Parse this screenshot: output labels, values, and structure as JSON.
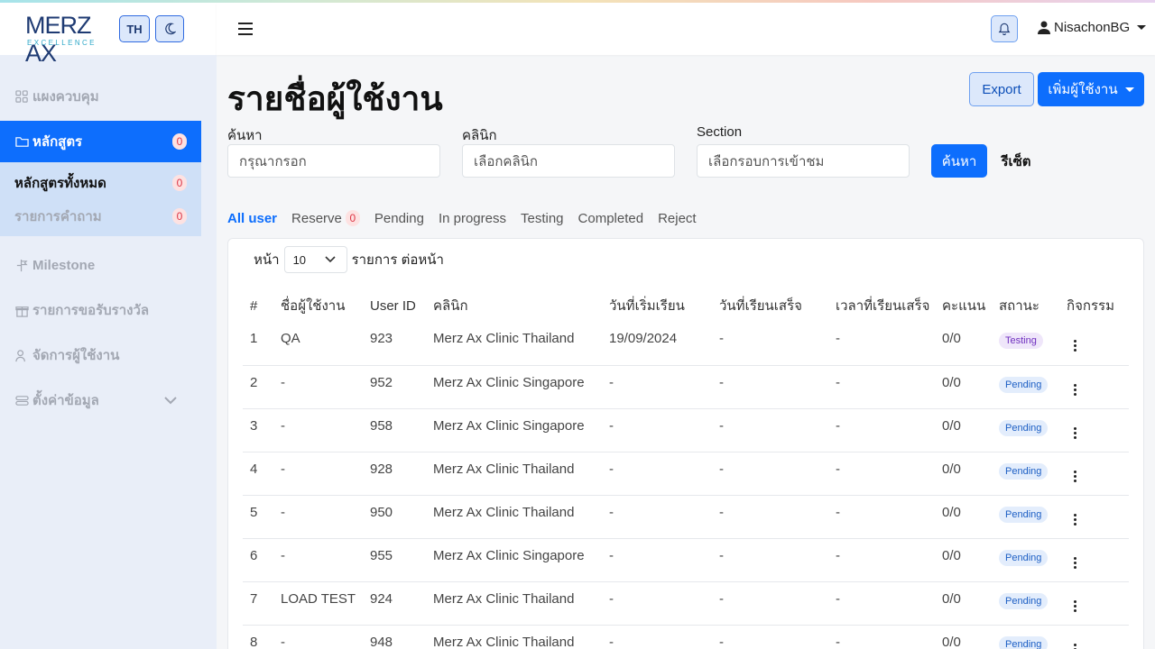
{
  "brand": {
    "logo_text": "MERZ AX",
    "logo_sub": "EXCELLENCE",
    "lang": "TH"
  },
  "header": {
    "username": "NisachonBG"
  },
  "sidebar": {
    "items": [
      {
        "label": "แผงควบคุม",
        "icon": "dashboard-icon"
      },
      {
        "label": "หลักสูตร",
        "icon": "folder-icon",
        "badge": "0",
        "active": true
      },
      {
        "label": "Milestone",
        "icon": "milestone-icon"
      },
      {
        "label": "รายการขอรับรางวัล",
        "icon": "gift-icon"
      },
      {
        "label": "จัดการผู้ใช้งาน",
        "icon": "users-icon"
      },
      {
        "label": "ตั้งค่าข้อมูล",
        "icon": "settings-icon"
      }
    ],
    "subitems": [
      {
        "label": "หลักสูตรทั้งหมด",
        "badge": "0"
      },
      {
        "label": "รายการคำถาม",
        "badge": "0"
      }
    ]
  },
  "page": {
    "title": "รายชื่อผู้ใช้งาน",
    "export_label": "Export",
    "add_label": "เพิ่มผู้ใช้งาน"
  },
  "filters": {
    "search_label": "ค้นหา",
    "search_placeholder": "กรุณากรอก",
    "clinic_label": "คลินิก",
    "clinic_placeholder": "เลือกคลินิก",
    "section_label": "Section",
    "section_placeholder": "เลือกรอบการเข้าชม",
    "search_button": "ค้นหา",
    "reset_button": "รีเซ็ต"
  },
  "tabs": [
    {
      "label": "All user",
      "active": true
    },
    {
      "label": "Reserve",
      "badge": "0"
    },
    {
      "label": "Pending"
    },
    {
      "label": "In progress"
    },
    {
      "label": "Testing"
    },
    {
      "label": "Completed"
    },
    {
      "label": "Reject"
    }
  ],
  "perpage": {
    "prefix": "หน้า",
    "value": "10",
    "suffix": "รายการ ต่อหน้า"
  },
  "table": {
    "columns": [
      "#",
      "ชื่อผู้ใช้งาน",
      "User ID",
      "คลินิก",
      "วันที่เริ่มเรียน",
      "วันที่เรียนเสร็จ",
      "เวลาที่เรียนเสร็จ",
      "คะแนน",
      "สถานะ",
      "กิจกรรม"
    ],
    "rows": [
      [
        "1",
        "QA",
        "923",
        "Merz Ax Clinic Thailand",
        "19/09/2024",
        "-",
        "-",
        "0/0",
        "Testing"
      ],
      [
        "2",
        "-",
        "952",
        "Merz Ax Clinic Singapore",
        "-",
        "-",
        "-",
        "0/0",
        "Pending"
      ],
      [
        "3",
        "-",
        "958",
        "Merz Ax Clinic Singapore",
        "-",
        "-",
        "-",
        "0/0",
        "Pending"
      ],
      [
        "4",
        "-",
        "928",
        "Merz Ax Clinic Thailand",
        "-",
        "-",
        "-",
        "0/0",
        "Pending"
      ],
      [
        "5",
        "-",
        "950",
        "Merz Ax Clinic Thailand",
        "-",
        "-",
        "-",
        "0/0",
        "Pending"
      ],
      [
        "6",
        "-",
        "955",
        "Merz Ax Clinic Singapore",
        "-",
        "-",
        "-",
        "0/0",
        "Pending"
      ],
      [
        "7",
        "LOAD TEST",
        "924",
        "Merz Ax Clinic Thailand",
        "-",
        "-",
        "-",
        "0/0",
        "Pending"
      ],
      [
        "8",
        "-",
        "948",
        "Merz Ax Clinic Thailand",
        "-",
        "-",
        "-",
        "0/0",
        "Pending"
      ]
    ]
  },
  "colors": {
    "primary": "#0d6efd",
    "sidebar_bg": "#e9eef8",
    "badge_red": "#dc3545"
  }
}
